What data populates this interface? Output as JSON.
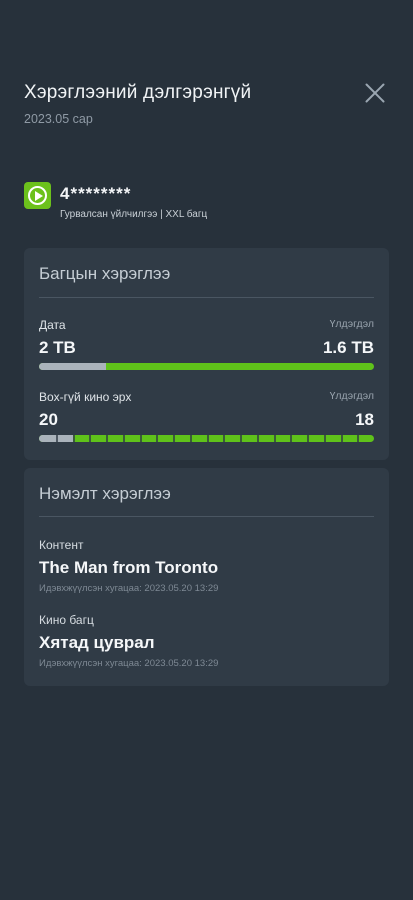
{
  "header": {
    "title": "Хэрэглээний дэлгэрэнгүй",
    "subtitle": "2023.05 сар"
  },
  "account": {
    "number": "4********",
    "plan": "Гурвалсан үйлчилгээ | XXL багц"
  },
  "usage_card": {
    "title": "Багцын хэрэглээ",
    "metrics": [
      {
        "label": "Дата",
        "remaining_label": "Үлдэгдэл",
        "total": "2 TB",
        "remaining": "1.6 TB",
        "remaining_fraction": 0.8,
        "segmented": false
      },
      {
        "label": "Box-гүй кино эрх",
        "remaining_label": "Үлдэгдэл",
        "total": "20",
        "remaining": "18",
        "remaining_fraction": 0.9,
        "segmented": true,
        "segments": 20
      }
    ]
  },
  "extra_card": {
    "title": "Нэмэлт хэрэглээ",
    "items": [
      {
        "key": "Контент",
        "value": "The Man from Toronto",
        "time": "Идэвхжүүлсэн хугацаа: 2023.05.20 13:29"
      },
      {
        "key": "Кино багц",
        "value": "Хятад цуврал",
        "time": "Идэвхжүүлсэн хугацаа: 2023.05.20 13:29"
      }
    ]
  },
  "colors": {
    "background": "#27313b",
    "card": "#303b46",
    "accent_green": "#5fc21a",
    "used_gray": "#aab3bb"
  },
  "icons": {
    "close": "close-icon",
    "logo": "play-logo-icon"
  }
}
